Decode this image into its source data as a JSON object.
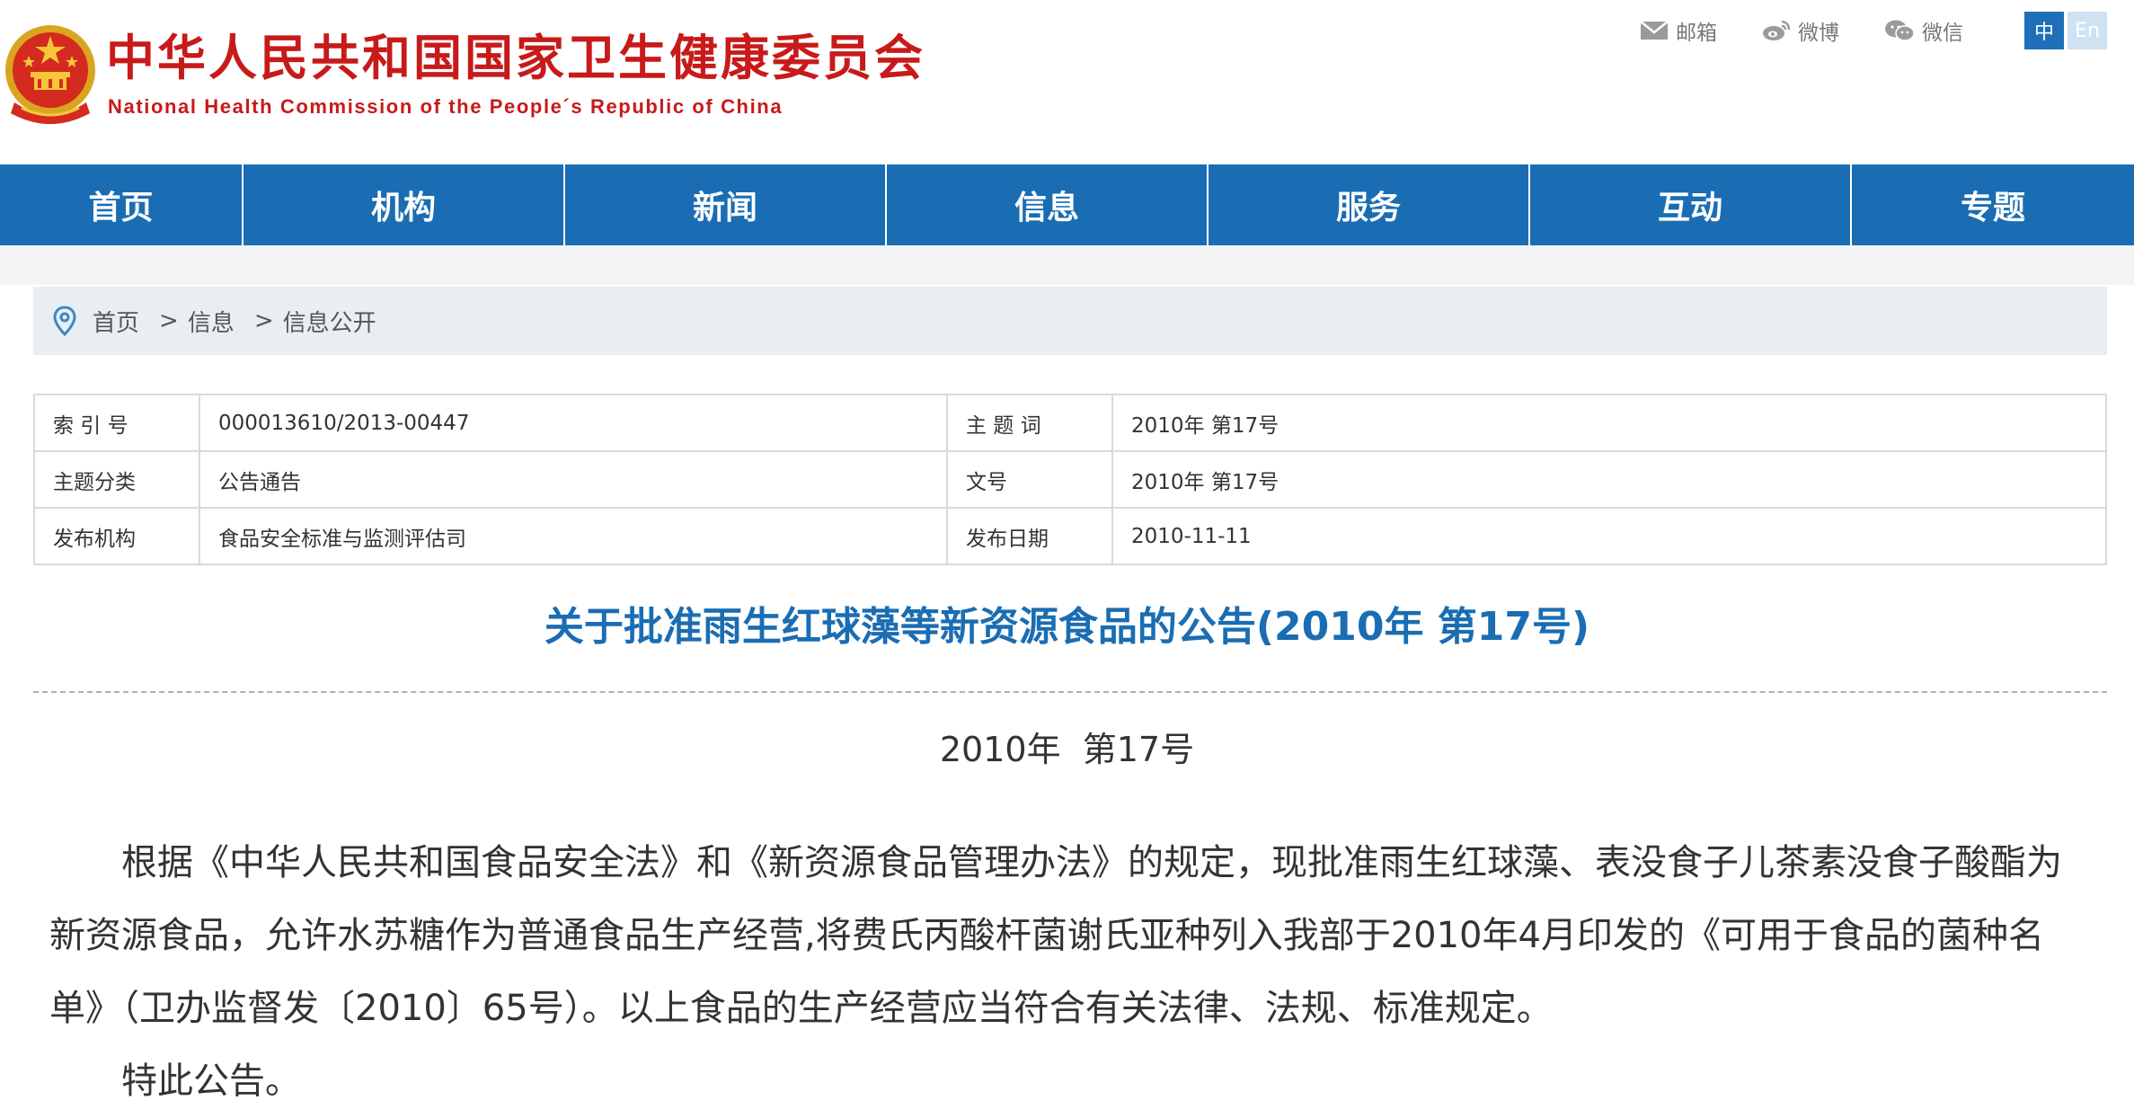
{
  "header": {
    "site_name_cn": "中华人民共和国国家卫生健康委员会",
    "site_name_en": "National Health Commission of the People´s Republic of China",
    "links": [
      {
        "label": "邮箱",
        "icon": "mail-icon"
      },
      {
        "label": "微博",
        "icon": "weibo-icon"
      },
      {
        "label": "微信",
        "icon": "wechat-icon"
      }
    ],
    "lang": {
      "cn": "中",
      "en": "En"
    }
  },
  "nav": {
    "items": [
      "首页",
      "机构",
      "新闻",
      "信息",
      "服务",
      "互动",
      "专题"
    ]
  },
  "breadcrumb": {
    "icon": "location-pin-icon",
    "items": [
      "首页",
      "信息",
      "信息公开"
    ],
    "separator": ">"
  },
  "meta": {
    "rows": [
      {
        "label_l": "索 引 号",
        "value_l": "000013610/2013-00447",
        "label_r": "主 题 词",
        "value_r": "2010年 第17号"
      },
      {
        "label_l": "主题分类",
        "value_l": "公告通告",
        "label_r": "文号",
        "value_r": "2010年 第17号"
      },
      {
        "label_l": "发布机构",
        "value_l": "食品安全标准与监测评估司",
        "label_r": "发布日期",
        "value_r": "2010-11-11"
      }
    ]
  },
  "article": {
    "title": "关于批准雨生红球藻等新资源食品的公告(2010年 第17号)",
    "doc_number": "2010年  第17号",
    "paragraphs": [
      "根据《中华人民共和国食品安全法》和《新资源食品管理办法》的规定，现批准雨生红球藻、表没食子儿茶素没食子酸酯为新资源食品，允许水苏糖作为普通食品生产经营,将费氏丙酸杆菌谢氏亚种列入我部于2010年4月印发的《可用于食品的菌种名单》（卫办监督发〔2010〕65号）。以上食品的生产经营应当符合有关法律、法规、标准规定。",
      "特此公告。"
    ]
  },
  "colors": {
    "brand_red": "#c81a1a",
    "nav_blue": "#1a6db3",
    "title_blue": "#1a6db3",
    "breadcrumb_bg": "#e9eef3"
  }
}
